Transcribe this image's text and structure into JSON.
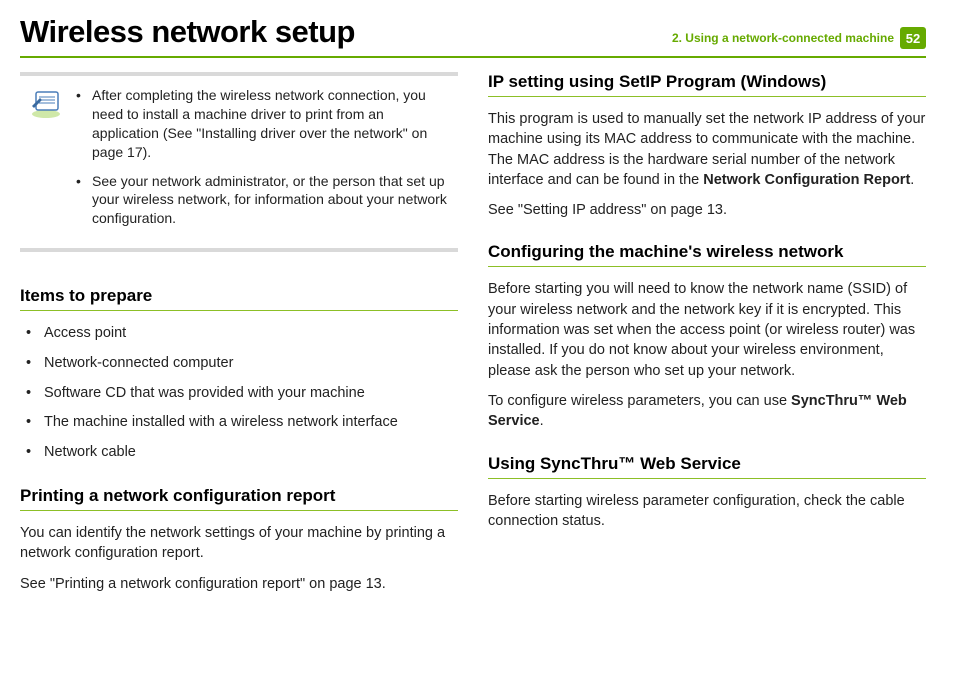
{
  "header": {
    "title": "Wireless network setup",
    "chapter": "2.  Using a network-connected machine",
    "pageNumber": "52"
  },
  "leftColumn": {
    "note": {
      "items": [
        "After completing the wireless network connection, you need to install a machine driver to print from an application (See \"Installing driver over the network\" on page 17).",
        "See your network administrator, or the person that set up your wireless network, for information about your network configuration."
      ]
    },
    "itemsHeading": "Items to prepare",
    "items": [
      "Access point",
      "Network-connected computer",
      "Software CD that was provided with your machine",
      "The machine installed with a wireless network interface",
      "Network cable"
    ],
    "printHeading": "Printing a network configuration report",
    "printP1": "You can identify the network settings of your machine by printing a network configuration report.",
    "printP2": "See \"Printing a network configuration report\" on page 13."
  },
  "rightColumn": {
    "ipHeading": "IP setting using SetIP Program (Windows)",
    "ipP1a": "This program is used to manually set the network IP address of your machine using its MAC address to communicate with the machine. The MAC address is the hardware serial number of the network interface and can be found in the ",
    "ipP1bold": "Network Configuration Report",
    "ipP1b": ".",
    "ipP2": "See \"Setting IP address\" on page 13.",
    "confHeading": "Configuring the machine's wireless network",
    "confP1": "Before starting you will need to know the network name (SSID) of your wireless network and the network key if it is encrypted. This information was set when the access point (or wireless router) was installed. If you do not know about your wireless environment, please ask the person who set up your network.",
    "confP2a": "To configure wireless parameters, you can use ",
    "confP2bold": "SyncThru™ Web Service",
    "confP2b": ".",
    "syncHeading": "Using SyncThru™ Web Service",
    "syncP1": "Before starting wireless parameter configuration, check the cable connection status."
  }
}
